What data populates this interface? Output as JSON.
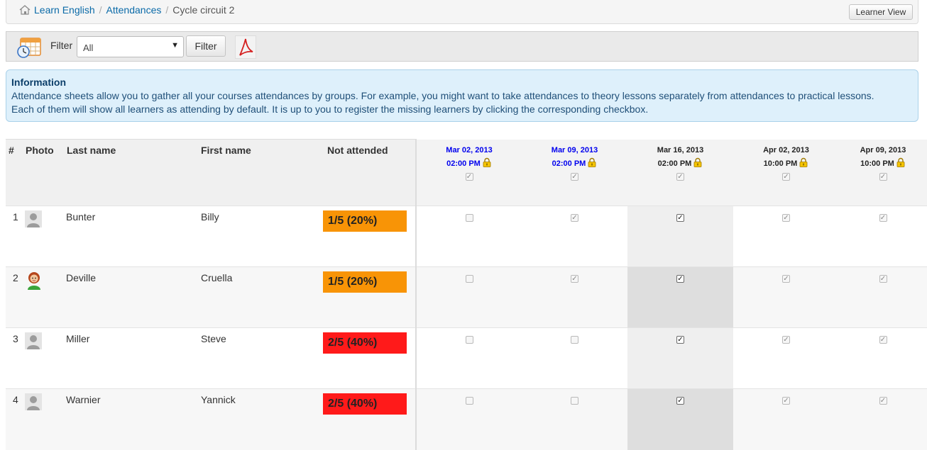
{
  "breadcrumb": {
    "items": [
      "Learn English",
      "Attendances"
    ],
    "current": "Cycle circuit 2",
    "separator": "/"
  },
  "header": {
    "learner_view_label": "Learner View"
  },
  "toolbar": {
    "filter_label": "Filter",
    "filter_value": "All",
    "filter_button": "Filter"
  },
  "info": {
    "title": "Information",
    "line1": "Attendance sheets allow you to gather all your courses attendances by groups. For example, you might want to take attendances to theory lessons separately from attendances to practical lessons.",
    "line2": "Each of them will show all learners as attending by default. It is up to you to register the missing learners by clicking the corresponding checkbox."
  },
  "table": {
    "columns": {
      "num": "#",
      "photo": "Photo",
      "last_name": "Last name",
      "first_name": "First name",
      "not_attended": "Not attended"
    },
    "dates": [
      {
        "date": "Mar 02, 2013",
        "time": "02:00 PM",
        "locked": true,
        "link": true
      },
      {
        "date": "Mar 09, 2013",
        "time": "02:00 PM",
        "locked": true,
        "link": true
      },
      {
        "date": "Mar 16, 2013",
        "time": "02:00 PM",
        "locked": true,
        "link": false
      },
      {
        "date": "Apr 02, 2013",
        "time": "10:00 PM",
        "locked": true,
        "link": false
      },
      {
        "date": "Apr 09, 2013",
        "time": "10:00 PM",
        "locked": true,
        "link": false
      }
    ],
    "rows": [
      {
        "num": "1",
        "last_name": "Bunter",
        "first_name": "Billy",
        "not_attended": "1/5 (20%)",
        "level": "orange",
        "avatar": "default",
        "checks": [
          false,
          true,
          true,
          true,
          true
        ]
      },
      {
        "num": "2",
        "last_name": "Deville",
        "first_name": "Cruella",
        "not_attended": "1/5 (20%)",
        "level": "orange",
        "avatar": "cruella",
        "checks": [
          false,
          true,
          true,
          true,
          true
        ]
      },
      {
        "num": "3",
        "last_name": "Miller",
        "first_name": "Steve",
        "not_attended": "2/5 (40%)",
        "level": "red",
        "avatar": "default",
        "checks": [
          false,
          false,
          true,
          true,
          true
        ]
      },
      {
        "num": "4",
        "last_name": "Warnier",
        "first_name": "Yannick",
        "not_attended": "2/5 (40%)",
        "level": "red",
        "avatar": "default",
        "checks": [
          false,
          false,
          true,
          true,
          true
        ]
      }
    ]
  },
  "colors": {
    "orange": "#f89406",
    "red": "#ff1a1a",
    "link": "#0a6aa8",
    "info_bg": "#def0fb"
  }
}
